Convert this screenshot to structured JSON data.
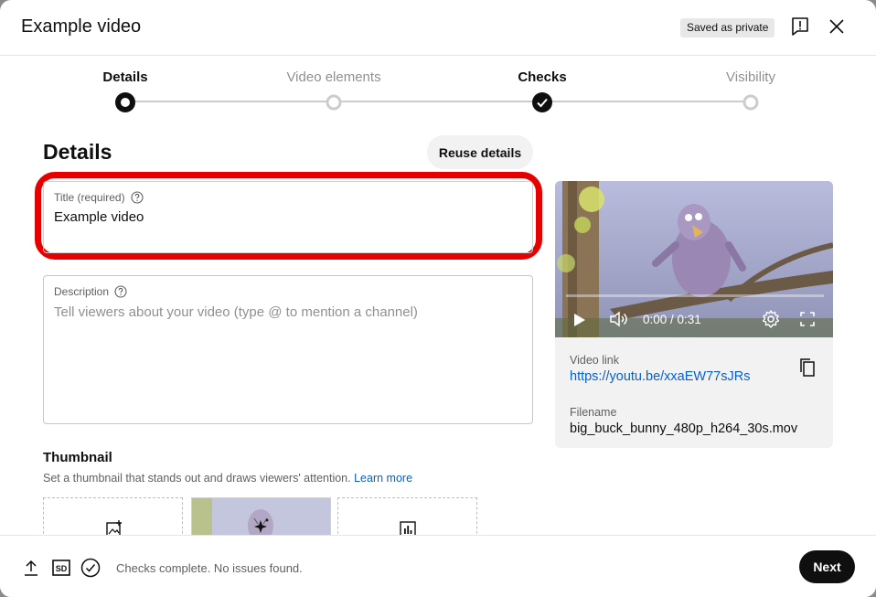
{
  "dialog": {
    "title": "Example video",
    "saved_badge": "Saved as private",
    "feedback_icon": "feedback-icon",
    "close_icon": "close-icon"
  },
  "stepper": {
    "steps": [
      {
        "label": "Details",
        "state": "active"
      },
      {
        "label": "Video elements",
        "state": "pending"
      },
      {
        "label": "Checks",
        "state": "done"
      },
      {
        "label": "Visibility",
        "state": "pending"
      }
    ]
  },
  "details": {
    "heading": "Details",
    "reuse_button": "Reuse details",
    "title_field": {
      "label": "Title (required)",
      "value": "Example video"
    },
    "description_field": {
      "label": "Description",
      "placeholder": "Tell viewers about your video (type @ to mention a channel)"
    }
  },
  "thumbnail": {
    "heading": "Thumbnail",
    "subtitle": "Set a thumbnail that stands out and draws viewers' attention.",
    "learn_more": "Learn more",
    "options": [
      "upload-image-icon",
      "auto-generated-thumbnail",
      "test-compare-icon"
    ]
  },
  "preview": {
    "time": "0:00 / 0:31",
    "video_link_label": "Video link",
    "video_link": "https://youtu.be/xxaEW77sJRs",
    "filename_label": "Filename",
    "filename": "big_buck_bunny_480p_h264_30s.mov"
  },
  "footer": {
    "status": "Checks complete. No issues found.",
    "next_button": "Next",
    "sd_badge": "SD"
  },
  "colors": {
    "highlight": "#e60000",
    "link": "#065fd4",
    "primary_button": "#0f0f0f"
  }
}
